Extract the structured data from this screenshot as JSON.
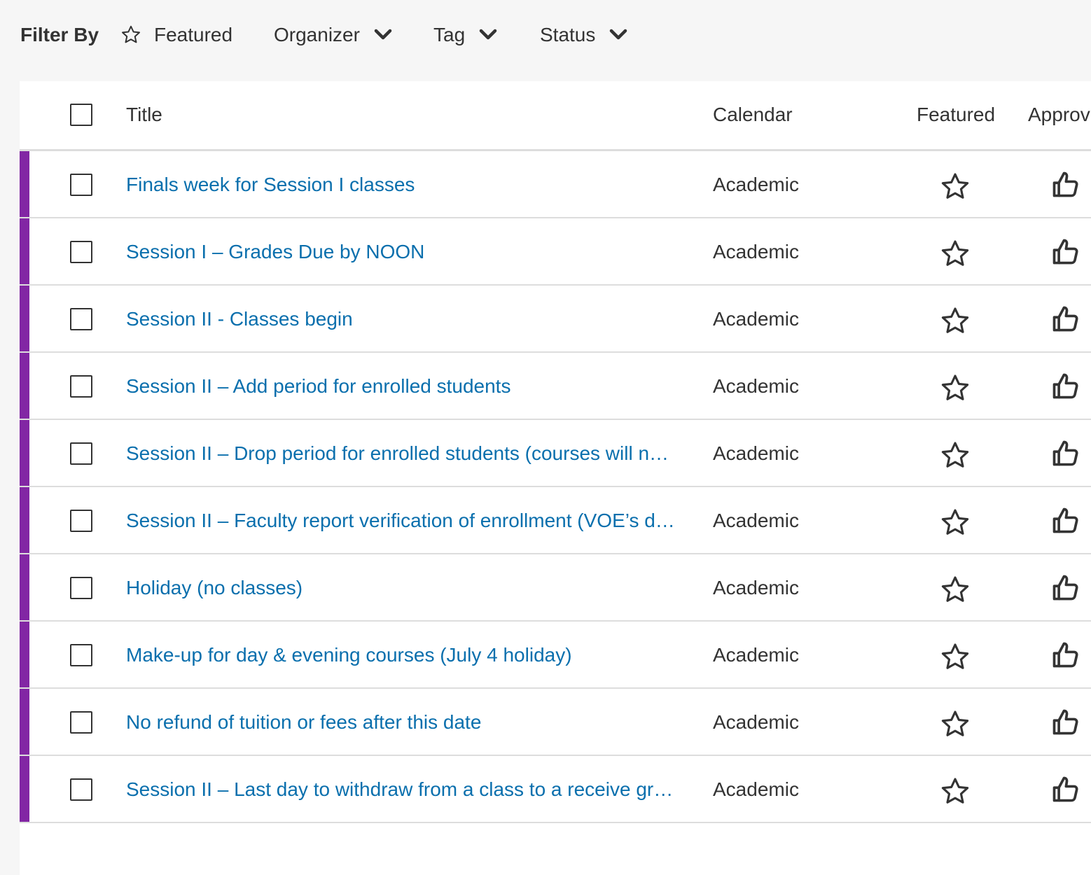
{
  "filter_bar": {
    "label": "Filter By",
    "featured": "Featured",
    "organizer": "Organizer",
    "tag": "Tag",
    "status": "Status"
  },
  "table": {
    "headers": {
      "title": "Title",
      "calendar": "Calendar",
      "featured": "Featured",
      "approve": "Approv"
    },
    "rows": [
      {
        "title": "Finals week for Session I classes",
        "calendar": "Academic"
      },
      {
        "title": "Session I – Grades Due by NOON",
        "calendar": "Academic"
      },
      {
        "title": "Session II - Classes begin",
        "calendar": "Academic"
      },
      {
        "title": "Session II – Add period for enrolled students",
        "calendar": "Academic"
      },
      {
        "title": "Session II – Drop period for enrolled students (courses will n…",
        "calendar": "Academic"
      },
      {
        "title": "Session II – Faculty report verification of enrollment (VOE’s d…",
        "calendar": "Academic"
      },
      {
        "title": "Holiday (no classes)",
        "calendar": "Academic"
      },
      {
        "title": "Make-up for day & evening courses (July 4 holiday)",
        "calendar": "Academic"
      },
      {
        "title": "No refund of tuition or fees after this date",
        "calendar": "Academic"
      },
      {
        "title": "Session II – Last day to withdraw from a class to a receive gr…",
        "calendar": "Academic"
      }
    ]
  },
  "colors": {
    "accent_bar": "#8226a4",
    "link": "#0a6fad",
    "text": "#333333",
    "page_bg": "#f6f6f6"
  },
  "icons": {
    "featured_filter": "star-outline-icon",
    "dropdown": "chevron-down-icon",
    "row_featured": "star-outline-icon",
    "row_approve": "thumbs-up-icon"
  }
}
